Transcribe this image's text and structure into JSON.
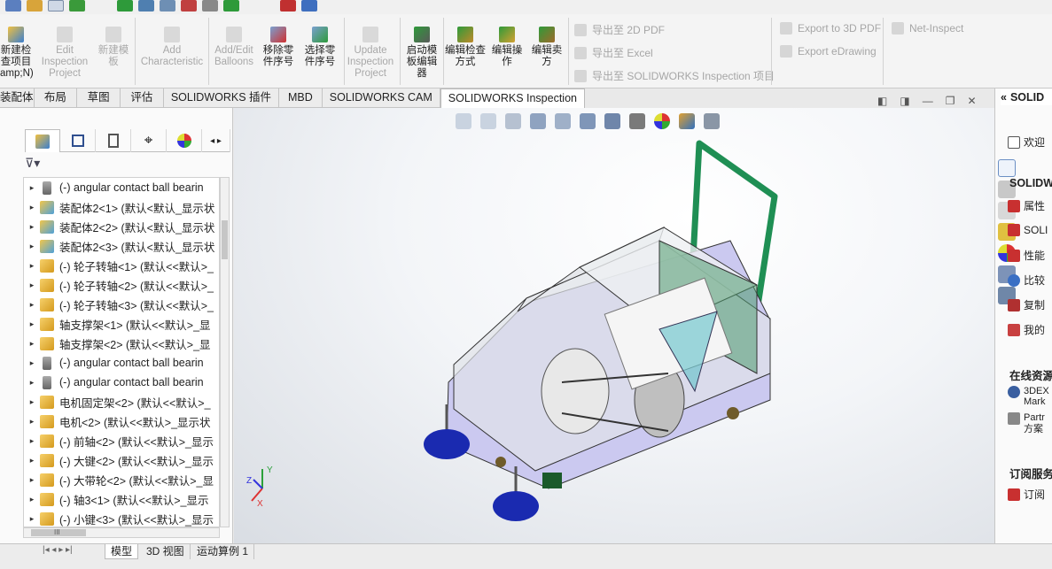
{
  "ribbon": {
    "buttons": [
      {
        "label": "新建检查项目amp;N)",
        "enabled": true
      },
      {
        "label": "Edit Inspection Project",
        "enabled": false
      },
      {
        "label": "新建模板",
        "enabled": false
      },
      {
        "label": "Add Characteristic",
        "enabled": false
      },
      {
        "label": "Add/Edit Balloons",
        "enabled": false
      },
      {
        "label": "移除零件序号",
        "enabled": true
      },
      {
        "label": "选择零件序号",
        "enabled": true
      },
      {
        "label": "Update Inspection Project",
        "enabled": false
      },
      {
        "label": "启动模板编辑器",
        "enabled": true
      },
      {
        "label": "编辑检查方式",
        "enabled": true
      },
      {
        "label": "编辑操作",
        "enabled": true
      },
      {
        "label": "编辑卖方",
        "enabled": true
      }
    ],
    "export_links": [
      "导出至 2D PDF",
      "导出至 Excel",
      "导出至 SOLIDWORKS Inspection 项目"
    ],
    "export_links_2": [
      "Export to 3D PDF",
      "Export eDrawing"
    ],
    "net_inspect": "Net-Inspect"
  },
  "tabs": [
    "装配体",
    "布局",
    "草图",
    "评估",
    "SOLIDWORKS 插件",
    "MBD",
    "SOLIDWORKS CAM",
    "SOLIDWORKS Inspection"
  ],
  "active_tab": "SOLIDWORKS Inspection",
  "tree": [
    {
      "label": "(-) angular contact ball bearin",
      "icon": "bolt"
    },
    {
      "label": "装配体2<1> (默认<默认_显示状",
      "icon": "asm"
    },
    {
      "label": "装配体2<2> (默认<默认_显示状",
      "icon": "asm"
    },
    {
      "label": "装配体2<3> (默认<默认_显示状",
      "icon": "asm"
    },
    {
      "label": "(-) 轮子转轴<1> (默认<<默认>_",
      "icon": "part"
    },
    {
      "label": "(-) 轮子转轴<2> (默认<<默认>_",
      "icon": "part"
    },
    {
      "label": "(-) 轮子转轴<3> (默认<<默认>_",
      "icon": "part"
    },
    {
      "label": "轴支撑架<1> (默认<<默认>_显",
      "icon": "part"
    },
    {
      "label": "轴支撑架<2> (默认<<默认>_显",
      "icon": "part"
    },
    {
      "label": "(-) angular contact ball bearin",
      "icon": "bolt"
    },
    {
      "label": "(-) angular contact ball bearin",
      "icon": "bolt"
    },
    {
      "label": "电机固定架<2> (默认<<默认>_",
      "icon": "part"
    },
    {
      "label": "电机<2> (默认<<默认>_显示状",
      "icon": "part"
    },
    {
      "label": "(-) 前轴<2> (默认<<默认>_显示",
      "icon": "part"
    },
    {
      "label": "(-) 大键<2> (默认<<默认>_显示",
      "icon": "part"
    },
    {
      "label": "(-) 大带轮<2> (默认<<默认>_显",
      "icon": "part"
    },
    {
      "label": "(-) 轴3<1> (默认<<默认>_显示",
      "icon": "part"
    },
    {
      "label": "(-) 小键<3> (默认<<默认>_显示",
      "icon": "part"
    }
  ],
  "bottom_tabs": [
    "模型",
    "3D 视图",
    "运动算例 1"
  ],
  "hscroll_label": "III",
  "right_panel": {
    "title": "SOLID",
    "welcome": "欢迎",
    "section1": "SOLIDW",
    "items1": [
      "属性",
      "SOLI",
      "性能",
      "比较",
      "复制",
      "我的"
    ],
    "section2": "在线资源",
    "items2": [
      "3DEX Mark",
      "Partr 方案"
    ],
    "section3": "订阅服务",
    "items3": [
      "订阅"
    ]
  },
  "triad": {
    "x": "X",
    "y": "Y",
    "z": "Z"
  }
}
